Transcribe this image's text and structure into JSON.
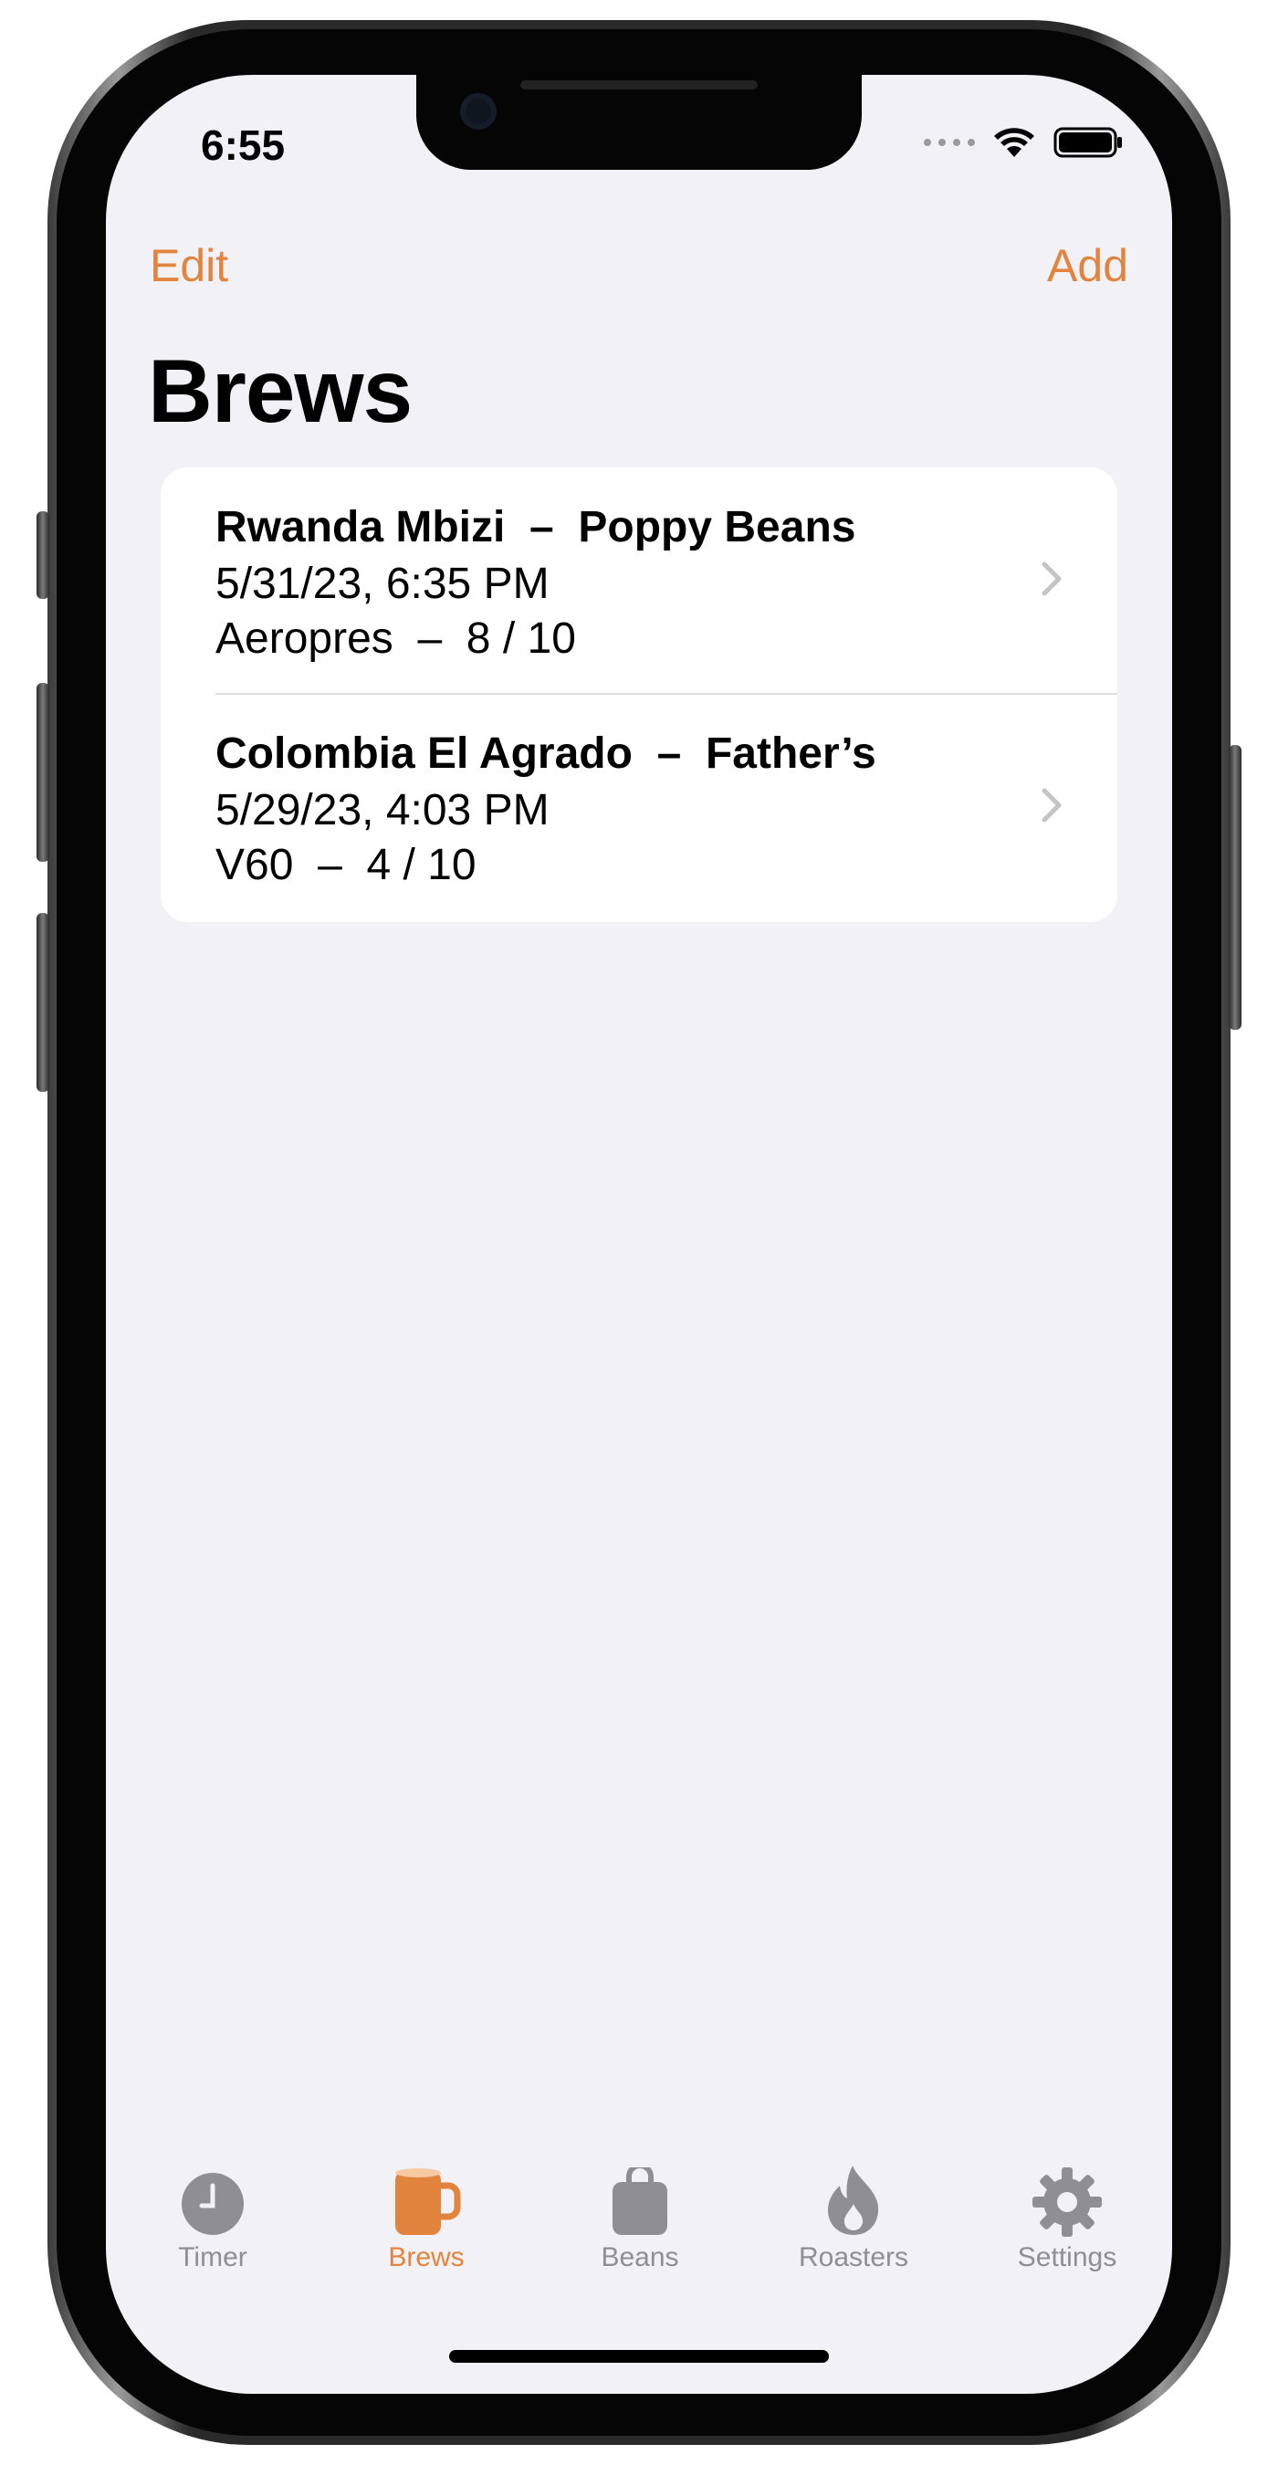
{
  "status_bar": {
    "time": "6:55"
  },
  "nav": {
    "edit_label": "Edit",
    "add_label": "Add",
    "title": "Brews"
  },
  "brews": [
    {
      "title": "Rwanda Mbizi  –  Poppy Beans",
      "date": "5/31/23, 6:35 PM",
      "detail": "Aeropres  –  8 / 10"
    },
    {
      "title": "Colombia El Agrado  –  Father’s",
      "date": "5/29/23, 4:03 PM",
      "detail": "V60  –  4 / 10"
    }
  ],
  "tabs": [
    {
      "label": "Timer",
      "icon": "timer-icon",
      "active": false
    },
    {
      "label": "Brews",
      "icon": "mug-icon",
      "active": true
    },
    {
      "label": "Beans",
      "icon": "bag-icon",
      "active": false
    },
    {
      "label": "Roasters",
      "icon": "flame-icon",
      "active": false
    },
    {
      "label": "Settings",
      "icon": "gear-icon",
      "active": false
    }
  ],
  "colors": {
    "accent": "#e2843d",
    "inactive": "#8e8e93",
    "background": "#f2f1f6"
  }
}
